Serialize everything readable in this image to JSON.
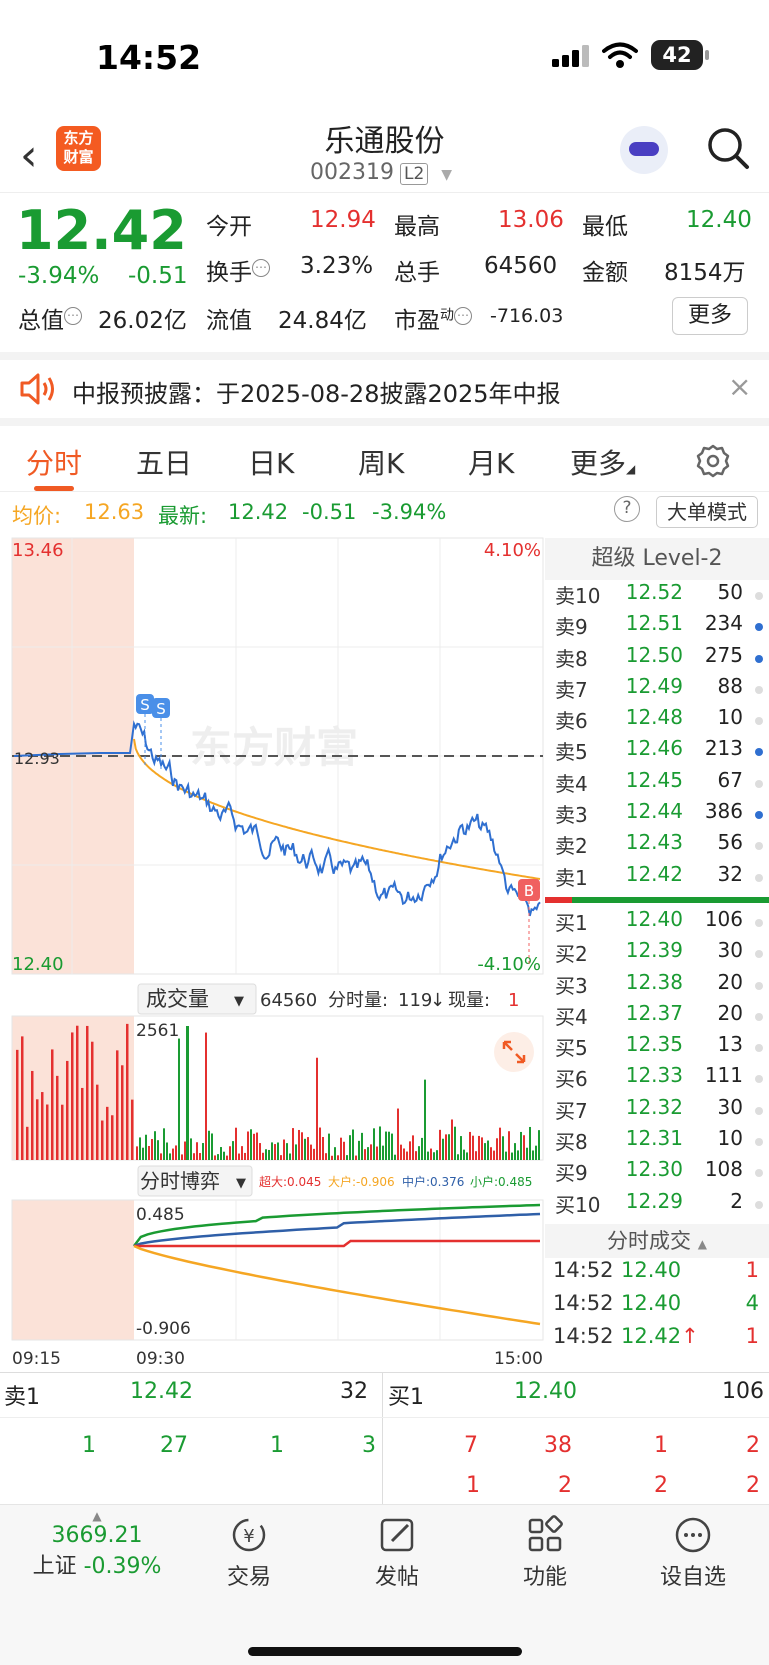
{
  "status": {
    "time": "14:52",
    "battery": "42"
  },
  "header": {
    "logo_line1": "东方",
    "logo_line2": "财富",
    "name": "乐通股份",
    "code": "002319",
    "level_badge": "L2"
  },
  "quote": {
    "price": "12.42",
    "pct": "-3.94%",
    "change": "-0.51",
    "open_label": "今开",
    "open": "12.94",
    "high_label": "最高",
    "high": "13.06",
    "low_label": "最低",
    "low": "12.40",
    "turnover_label": "换手",
    "turnover": "3.23%",
    "volume_label": "总手",
    "volume": "64560",
    "amount_label": "金额",
    "amount": "8154万",
    "mcap_label": "总值",
    "mcap": "26.02亿",
    "float_label": "流值",
    "float": "24.84亿",
    "pe_label": "市盈",
    "pe_sup": "动",
    "pe": "-716.03",
    "more": "更多"
  },
  "notice": {
    "text": "中报预披露：于2025-08-28披露2025年中报"
  },
  "tabs": [
    "分时",
    "五日",
    "日K",
    "周K",
    "月K",
    "更多"
  ],
  "infobar": {
    "avg_label": "均价:",
    "avg": "12.63",
    "latest_label": "最新:",
    "latest": "12.42",
    "chg": "-0.51",
    "pct": "-3.94%",
    "mode_btn": "大单模式"
  },
  "chart_data": [
    {
      "type": "line",
      "ylim": [
        12.4,
        13.46
      ],
      "y_top_label": "13.46",
      "y_bottom_label": "12.40",
      "pct_top": "4.10%",
      "pct_bottom": "-4.10%",
      "prev_close_label": "12.93",
      "watermark": "东方财富",
      "markers": [
        "S",
        "S",
        "B"
      ],
      "colors": {
        "price": "#2f6fd0",
        "avg": "#f5a623",
        "ref": "#555555"
      }
    },
    {
      "type": "bar",
      "title": "成交量",
      "total": "64560",
      "tick_vol_label": "分时量:",
      "tick_vol": "119",
      "now_label": "现量:",
      "now": "1",
      "ymax_label": "2561"
    },
    {
      "type": "line",
      "title": "分时博弈",
      "series": [
        {
          "name": "超大",
          "value": "0.045",
          "color": "#e4302f"
        },
        {
          "name": "大户",
          "value": "-0.906",
          "color": "#f5a623"
        },
        {
          "name": "中户",
          "value": "0.376",
          "color": "#2f5fa8"
        },
        {
          "name": "小户",
          "value": "0.485",
          "color": "#1a9b32"
        }
      ],
      "ymax_label": "0.485",
      "ymin_label": "-0.906",
      "x_labels": [
        "09:15",
        "09:30",
        "15:00"
      ]
    }
  ],
  "book": {
    "title": "超级 Level-2",
    "asks": [
      {
        "n": "卖10",
        "p": "12.52",
        "v": "50",
        "dot": "gray"
      },
      {
        "n": "卖9",
        "p": "12.51",
        "v": "234",
        "dot": "blue"
      },
      {
        "n": "卖8",
        "p": "12.50",
        "v": "275",
        "dot": "blue"
      },
      {
        "n": "卖7",
        "p": "12.49",
        "v": "88",
        "dot": "gray"
      },
      {
        "n": "卖6",
        "p": "12.48",
        "v": "10",
        "dot": "gray"
      },
      {
        "n": "卖5",
        "p": "12.46",
        "v": "213",
        "dot": "blue"
      },
      {
        "n": "卖4",
        "p": "12.45",
        "v": "67",
        "dot": "gray"
      },
      {
        "n": "卖3",
        "p": "12.44",
        "v": "386",
        "dot": "blue"
      },
      {
        "n": "卖2",
        "p": "12.43",
        "v": "56",
        "dot": "gray"
      },
      {
        "n": "卖1",
        "p": "12.42",
        "v": "32",
        "dot": "gray"
      }
    ],
    "bids": [
      {
        "n": "买1",
        "p": "12.40",
        "v": "106",
        "dot": "gray"
      },
      {
        "n": "买2",
        "p": "12.39",
        "v": "30",
        "dot": "gray"
      },
      {
        "n": "买3",
        "p": "12.38",
        "v": "20",
        "dot": "gray"
      },
      {
        "n": "买4",
        "p": "12.37",
        "v": "20",
        "dot": "gray"
      },
      {
        "n": "买5",
        "p": "12.35",
        "v": "13",
        "dot": "gray"
      },
      {
        "n": "买6",
        "p": "12.33",
        "v": "111",
        "dot": "gray"
      },
      {
        "n": "买7",
        "p": "12.32",
        "v": "30",
        "dot": "gray"
      },
      {
        "n": "买8",
        "p": "12.31",
        "v": "10",
        "dot": "gray"
      },
      {
        "n": "买9",
        "p": "12.30",
        "v": "108",
        "dot": "gray"
      },
      {
        "n": "买10",
        "p": "12.29",
        "v": "2",
        "dot": "gray"
      }
    ],
    "trades_title": "分时成交",
    "trades": [
      {
        "t": "14:52",
        "p": "12.40",
        "v": "1",
        "arrow": ""
      },
      {
        "t": "14:52",
        "p": "12.40",
        "v": "4",
        "arrow": ""
      },
      {
        "t": "14:52",
        "p": "12.42",
        "v": "1",
        "arrow": "↑"
      }
    ]
  },
  "sellbuy": {
    "sell_label": "卖1",
    "sell_price": "12.42",
    "sell_vol": "32",
    "sell_nums": [
      "1",
      "27",
      "1",
      "3"
    ],
    "buy_label": "买1",
    "buy_price": "12.40",
    "buy_vol": "106",
    "buy_nums_row1": [
      "7",
      "38",
      "1",
      "2"
    ],
    "buy_nums_row2": [
      "1",
      "2",
      "2",
      "2"
    ]
  },
  "nav": {
    "index_value": "3669.21",
    "index_name": "上证",
    "index_pct": "-0.39%",
    "items": [
      "交易",
      "发帖",
      "功能",
      "设自选"
    ]
  }
}
